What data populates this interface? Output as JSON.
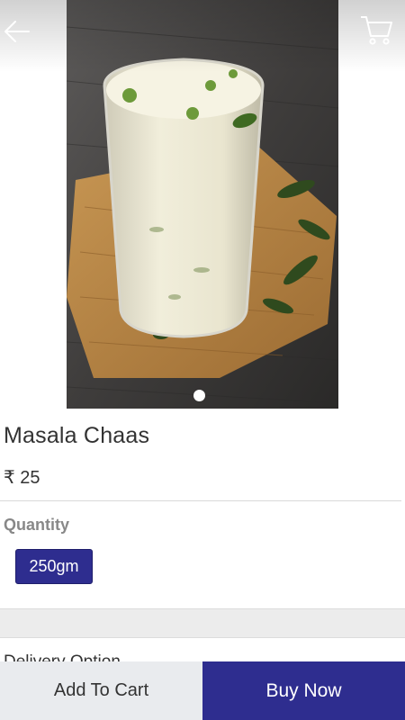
{
  "product": {
    "image_desc": "glass of masala chaas on burlap mat",
    "title": "Masala Chaas",
    "price": "₹ 25",
    "carousel_active_index": 1
  },
  "header": {
    "back_icon": "arrow-left-icon",
    "cart_icon": "cart-icon"
  },
  "quantity": {
    "label": "Quantity",
    "selected_option": "250gm"
  },
  "delivery": {
    "label": "Delivery Option"
  },
  "actions": {
    "add_to_cart": "Add To Cart",
    "buy_now": "Buy Now"
  },
  "colors": {
    "primary": "#2e2d8f",
    "secondary_button_bg": "#e9ebee"
  }
}
